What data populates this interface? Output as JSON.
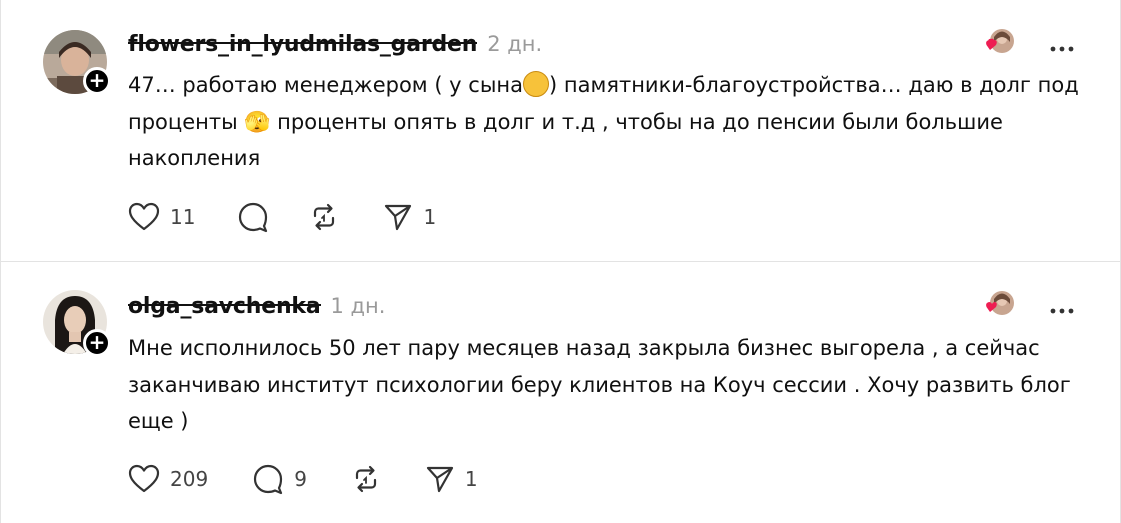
{
  "posts": [
    {
      "username": "flowers_in_lyudmilas_garden",
      "time": "2 дн.",
      "text_before_emoji": "47… работаю менеджером ( у сына",
      "text_after_emoji": ") памятники-благоустройства… даю в долг под проценты 🫣 проценты опять в долг и т.д , чтобы на до пенсии были большие накопления",
      "likes": "11",
      "replies": "",
      "reposts": "",
      "shares": "1"
    },
    {
      "username": "olga_savchenka",
      "time": "1 дн.",
      "text": "Мне исполнилось 50 лет пару месяцев назад закрыла бизнес выгорела , а сейчас заканчиваю институт психологии беру клиентов на Коуч сессии . Хочу развить блог еще )",
      "likes": "209",
      "replies": "9",
      "reposts": "",
      "shares": "1"
    }
  ],
  "follow_symbol": "+",
  "icons": {
    "like": "heart-icon",
    "reply": "comment-icon",
    "repost": "repost-icon",
    "share": "send-icon",
    "more": "more-dots-icon",
    "emoji": "rolling-laughing-emoji-icon"
  },
  "colors": {
    "heart_badge": "#ee1d52",
    "muted": "#9a9a9a",
    "text": "#101010"
  }
}
